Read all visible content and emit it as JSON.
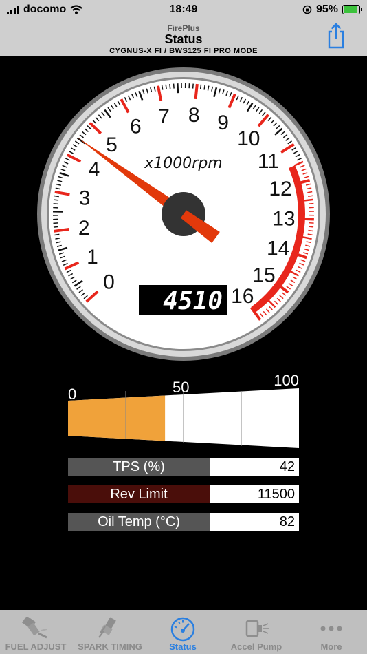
{
  "status_bar": {
    "carrier": "docomo",
    "time": "18:49",
    "battery": "95%"
  },
  "nav": {
    "app_name": "FirePlus",
    "title": "Status",
    "subtitle": "CYGNUS-X FI / BWS125 FI PRO MODE",
    "share_icon": "share-icon"
  },
  "gauge": {
    "unit_label": "x1000rpm",
    "scale_labels": [
      "0",
      "1",
      "2",
      "3",
      "4",
      "5",
      "6",
      "7",
      "8",
      "9",
      "10",
      "11",
      "12",
      "13",
      "14",
      "15",
      "16"
    ],
    "readout": "4510",
    "needle_rpm": 4.51,
    "redline_start_rpm": 11.5,
    "needle_color": "#e2390b",
    "redline_color": "#e8261c"
  },
  "throttle_bar": {
    "label_min": "0",
    "label_mid": "50",
    "label_max": "100",
    "fill_percent": 42,
    "fill_color": "#f0a23a"
  },
  "readings": [
    {
      "label": "TPS (%)",
      "value": "42",
      "label_bg": "#555555"
    },
    {
      "label": "Rev Limit",
      "value": "11500",
      "label_bg": "#4a0e0a"
    },
    {
      "label": "Oil Temp (°C)",
      "value": "82",
      "label_bg": "#555555"
    }
  ],
  "tabs": [
    {
      "label": "FUEL ADJUST",
      "icon": "fuel-injector-icon",
      "active": false
    },
    {
      "label": "SPARK TIMING",
      "icon": "spark-plug-icon",
      "active": false
    },
    {
      "label": "Status",
      "icon": "speedometer-icon",
      "active": true
    },
    {
      "label": "Accel Pump",
      "icon": "accel-pump-icon",
      "active": false
    },
    {
      "label": "More",
      "icon": "more-dots-icon",
      "active": false
    }
  ]
}
